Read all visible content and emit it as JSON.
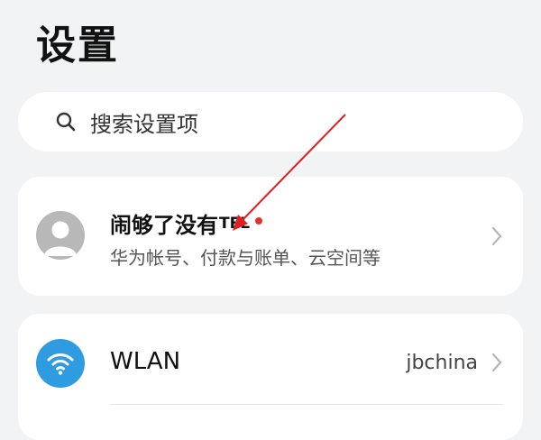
{
  "page": {
    "title": "设置"
  },
  "search": {
    "placeholder": "搜索设置项",
    "icon": "search-icon"
  },
  "account": {
    "name": "闹够了没有",
    "name_suffix": "TEL",
    "subtitle": "华为帐号、付款与账单、云空间等",
    "avatar_icon": "user-avatar-icon",
    "has_notification_dot": true
  },
  "wlan": {
    "label": "WLAN",
    "value": "jbchina",
    "icon": "wifi-icon"
  },
  "colors": {
    "background": "#f1f3f5",
    "card": "#ffffff",
    "wifi_icon_bg": "#2f9be0",
    "notification_dot": "#e8312a",
    "annotation_arrow": "#e02020"
  }
}
